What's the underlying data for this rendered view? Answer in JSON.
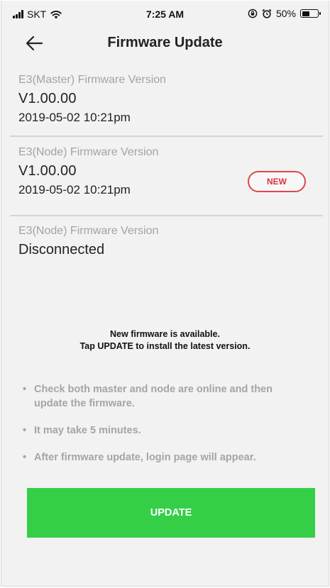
{
  "status_bar": {
    "carrier": "SKT",
    "time": "7:25 AM",
    "battery": "50%",
    "battery_level": 0.5,
    "icons": [
      "signal-icon",
      "wifi-icon",
      "lock-rotation-icon",
      "alarm-icon",
      "battery-icon"
    ]
  },
  "header": {
    "title": "Firmware Update",
    "back_icon": "back-arrow-icon"
  },
  "firmware": [
    {
      "label": "E3(Master) Firmware Version",
      "version": "V1.00.00",
      "date": "2019-05-02 10:21pm"
    },
    {
      "label": "E3(Node) Firmware Version",
      "version": "V1.00.00",
      "date": "2019-05-02 10:21pm",
      "badge": "NEW"
    },
    {
      "label": "E3(Node) Firmware Version",
      "status": "Disconnected"
    }
  ],
  "notice": {
    "line1": "New firmware is available.",
    "line2": "Tap UPDATE to install the latest version."
  },
  "tips": [
    "Check both master and node are online and then update the firmware.",
    "It may take 5 minutes.",
    "After firmware update, login page will appear."
  ],
  "bullet": "•",
  "update_button": "UPDATE",
  "colors": {
    "accent": "#34cf47",
    "badge": "#e0474c",
    "label": "#a3a3a3",
    "background": "#f2f2f2"
  }
}
